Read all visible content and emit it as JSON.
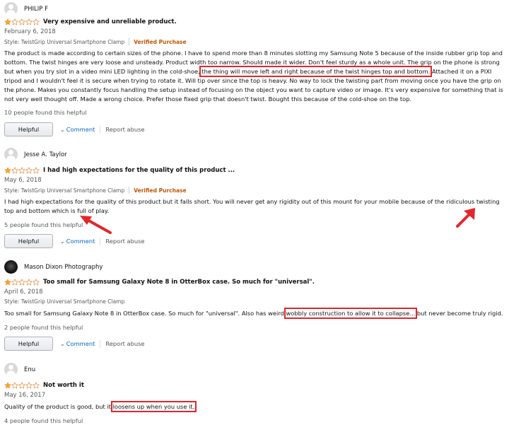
{
  "labels": {
    "helpful_button": "Helpful",
    "comment_link": "Comment",
    "report_link": "Report abuse",
    "verified": "Verified Purchase"
  },
  "colors": {
    "highlight": "#e3262b",
    "star_fill": "#ffa41c",
    "verified": "#c45500",
    "link": "#0066c0"
  },
  "reviews": [
    {
      "author": "PHILIP F",
      "rating": 1,
      "title": "Very expensive and unreliable product.",
      "date": "February 6, 2018",
      "style": "Style: TwistGrip Universal Smartphone Clamp",
      "body_pre": "The product is made according to certain sizes of the phone. I have to spend more than 8 minutes slotting my Samsung Note 5 because of the inside rubber grip top and bottom. The twist hinges are very loose and unsteady. Product width too narrow. Should made it wider. Don't feel sturdy as a whole unit. The grip on the phone is strong but when you try slot in a video mini LED lighting in the cold-shoe, ",
      "body_hl": "the thing will move left and right because of the twist hinges top and bottom.",
      "body_post": " Attached it on a PIXI tripod and I wouldn't feel it is secure when trying to rotate it. Will tip over since the top is heavy. No way to lock the twisting part from moving once you have the grip on the phone. Makes you constantly focus handling the setup instead of focusing on the object you want to capture video or image. It's very expensive for something that is not very well thought off. Made a wrong choice. Prefer those fixed grip that doesn't twist. Bought this because of the cold-shoe on the top.",
      "helpful_count": "10 people found this helpful"
    },
    {
      "author": "Jesse A. Taylor",
      "rating": 1,
      "title": "I had high expectations for the quality of this product ...",
      "date": "May 6, 2018",
      "style": "Style: TwistGrip Universal Smartphone Clamp",
      "body_pre": "I had high expectations for the quality of this product but it falls short. You will never get any rigidity out of this mount for your mobile because of the ridiculous twisting top and bottom which is full of play.",
      "body_hl": "",
      "body_post": "",
      "helpful_count": "5 people found this helpful"
    },
    {
      "author": "Mason Dixon Photography",
      "rating": 1,
      "title": "Too small for Samsung Galaxy Note 8 in OtterBox case. So much for \"universal\".",
      "date": "April 6, 2018",
      "style": "Style: TwistGrip Universal Smartphone Clamp",
      "body_pre": "Too small for Samsung Galaxy Note 8 in OtterBox case. So much for \"universal\". Also has weird,",
      "body_hl": "wobbly construction to allow it to collapse...",
      "body_post": " but never become truly rigid.",
      "helpful_count": "2 people found this helpful"
    },
    {
      "author": "Enu",
      "rating": 1,
      "title": "Not worth it",
      "date": "May 16, 2017",
      "style": "",
      "body_pre": "Quality of the product is good, but it ",
      "body_hl": "loosens up when you use it.",
      "body_post": "",
      "helpful_count": "4 people found this helpful"
    }
  ]
}
